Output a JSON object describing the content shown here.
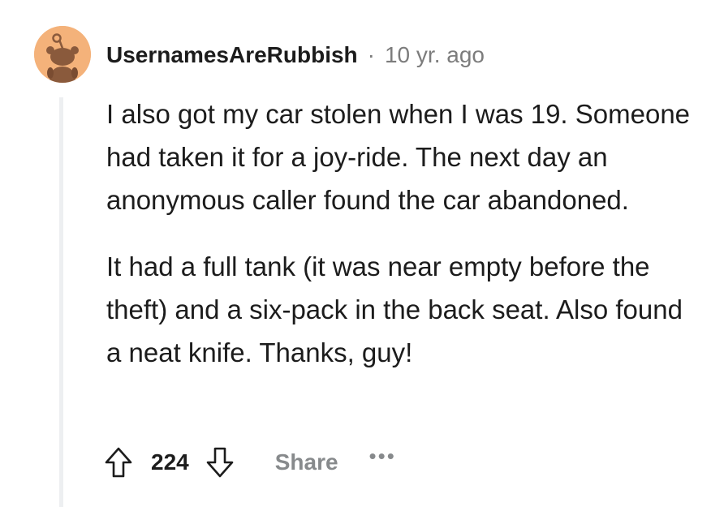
{
  "comment": {
    "author": "UsernamesAreRubbish",
    "separator": "·",
    "time": "10 yr. ago",
    "paragraphs": [
      "I also got my car stolen when I was 19. Someone had taken it for a joy-ride. The next day an anonymous caller found the car abandoned.",
      "It had a full tank (it was near empty before the theft) and a six-pack in the back seat. Also found a neat knife. Thanks, guy!"
    ],
    "score": "224",
    "share_label": "Share",
    "more_label": "•••",
    "icons": {
      "avatar": "snoo-avatar-icon",
      "upvote": "upvote-arrow-icon",
      "downvote": "downvote-arrow-icon"
    }
  },
  "colors": {
    "avatar_bg": "#f4b27a",
    "text": "#1c1c1c",
    "muted": "#7c7c7c",
    "thread_line": "#edeff1"
  }
}
